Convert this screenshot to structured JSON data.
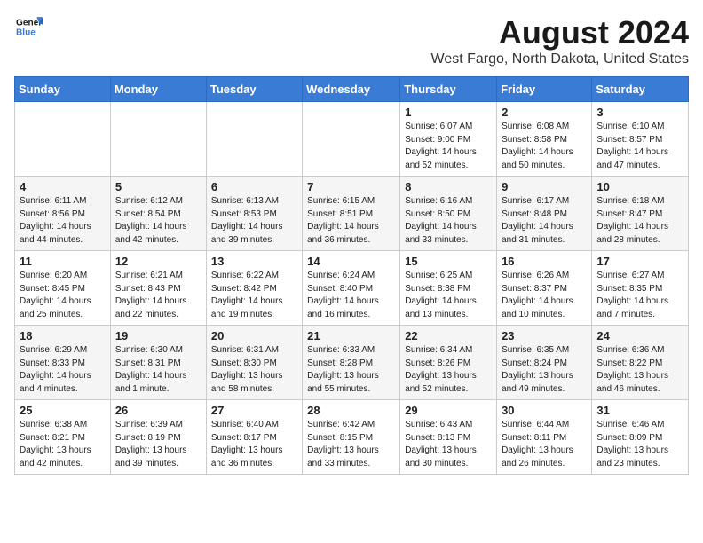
{
  "header": {
    "logo_line1": "General",
    "logo_line2": "Blue",
    "month": "August 2024",
    "location": "West Fargo, North Dakota, United States"
  },
  "weekdays": [
    "Sunday",
    "Monday",
    "Tuesday",
    "Wednesday",
    "Thursday",
    "Friday",
    "Saturday"
  ],
  "weeks": [
    [
      {
        "day": "",
        "info": ""
      },
      {
        "day": "",
        "info": ""
      },
      {
        "day": "",
        "info": ""
      },
      {
        "day": "",
        "info": ""
      },
      {
        "day": "1",
        "info": "Sunrise: 6:07 AM\nSunset: 9:00 PM\nDaylight: 14 hours\nand 52 minutes."
      },
      {
        "day": "2",
        "info": "Sunrise: 6:08 AM\nSunset: 8:58 PM\nDaylight: 14 hours\nand 50 minutes."
      },
      {
        "day": "3",
        "info": "Sunrise: 6:10 AM\nSunset: 8:57 PM\nDaylight: 14 hours\nand 47 minutes."
      }
    ],
    [
      {
        "day": "4",
        "info": "Sunrise: 6:11 AM\nSunset: 8:56 PM\nDaylight: 14 hours\nand 44 minutes."
      },
      {
        "day": "5",
        "info": "Sunrise: 6:12 AM\nSunset: 8:54 PM\nDaylight: 14 hours\nand 42 minutes."
      },
      {
        "day": "6",
        "info": "Sunrise: 6:13 AM\nSunset: 8:53 PM\nDaylight: 14 hours\nand 39 minutes."
      },
      {
        "day": "7",
        "info": "Sunrise: 6:15 AM\nSunset: 8:51 PM\nDaylight: 14 hours\nand 36 minutes."
      },
      {
        "day": "8",
        "info": "Sunrise: 6:16 AM\nSunset: 8:50 PM\nDaylight: 14 hours\nand 33 minutes."
      },
      {
        "day": "9",
        "info": "Sunrise: 6:17 AM\nSunset: 8:48 PM\nDaylight: 14 hours\nand 31 minutes."
      },
      {
        "day": "10",
        "info": "Sunrise: 6:18 AM\nSunset: 8:47 PM\nDaylight: 14 hours\nand 28 minutes."
      }
    ],
    [
      {
        "day": "11",
        "info": "Sunrise: 6:20 AM\nSunset: 8:45 PM\nDaylight: 14 hours\nand 25 minutes."
      },
      {
        "day": "12",
        "info": "Sunrise: 6:21 AM\nSunset: 8:43 PM\nDaylight: 14 hours\nand 22 minutes."
      },
      {
        "day": "13",
        "info": "Sunrise: 6:22 AM\nSunset: 8:42 PM\nDaylight: 14 hours\nand 19 minutes."
      },
      {
        "day": "14",
        "info": "Sunrise: 6:24 AM\nSunset: 8:40 PM\nDaylight: 14 hours\nand 16 minutes."
      },
      {
        "day": "15",
        "info": "Sunrise: 6:25 AM\nSunset: 8:38 PM\nDaylight: 14 hours\nand 13 minutes."
      },
      {
        "day": "16",
        "info": "Sunrise: 6:26 AM\nSunset: 8:37 PM\nDaylight: 14 hours\nand 10 minutes."
      },
      {
        "day": "17",
        "info": "Sunrise: 6:27 AM\nSunset: 8:35 PM\nDaylight: 14 hours\nand 7 minutes."
      }
    ],
    [
      {
        "day": "18",
        "info": "Sunrise: 6:29 AM\nSunset: 8:33 PM\nDaylight: 14 hours\nand 4 minutes."
      },
      {
        "day": "19",
        "info": "Sunrise: 6:30 AM\nSunset: 8:31 PM\nDaylight: 14 hours\nand 1 minute."
      },
      {
        "day": "20",
        "info": "Sunrise: 6:31 AM\nSunset: 8:30 PM\nDaylight: 13 hours\nand 58 minutes."
      },
      {
        "day": "21",
        "info": "Sunrise: 6:33 AM\nSunset: 8:28 PM\nDaylight: 13 hours\nand 55 minutes."
      },
      {
        "day": "22",
        "info": "Sunrise: 6:34 AM\nSunset: 8:26 PM\nDaylight: 13 hours\nand 52 minutes."
      },
      {
        "day": "23",
        "info": "Sunrise: 6:35 AM\nSunset: 8:24 PM\nDaylight: 13 hours\nand 49 minutes."
      },
      {
        "day": "24",
        "info": "Sunrise: 6:36 AM\nSunset: 8:22 PM\nDaylight: 13 hours\nand 46 minutes."
      }
    ],
    [
      {
        "day": "25",
        "info": "Sunrise: 6:38 AM\nSunset: 8:21 PM\nDaylight: 13 hours\nand 42 minutes."
      },
      {
        "day": "26",
        "info": "Sunrise: 6:39 AM\nSunset: 8:19 PM\nDaylight: 13 hours\nand 39 minutes."
      },
      {
        "day": "27",
        "info": "Sunrise: 6:40 AM\nSunset: 8:17 PM\nDaylight: 13 hours\nand 36 minutes."
      },
      {
        "day": "28",
        "info": "Sunrise: 6:42 AM\nSunset: 8:15 PM\nDaylight: 13 hours\nand 33 minutes."
      },
      {
        "day": "29",
        "info": "Sunrise: 6:43 AM\nSunset: 8:13 PM\nDaylight: 13 hours\nand 30 minutes."
      },
      {
        "day": "30",
        "info": "Sunrise: 6:44 AM\nSunset: 8:11 PM\nDaylight: 13 hours\nand 26 minutes."
      },
      {
        "day": "31",
        "info": "Sunrise: 6:46 AM\nSunset: 8:09 PM\nDaylight: 13 hours\nand 23 minutes."
      }
    ]
  ]
}
